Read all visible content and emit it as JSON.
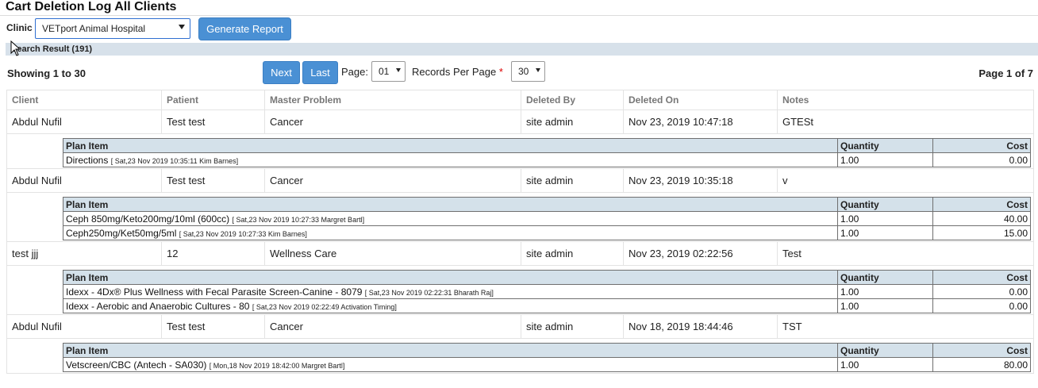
{
  "page": {
    "title": "Cart Deletion Log All Clients"
  },
  "filter": {
    "clinic_label": "Clinic",
    "clinic_value": "VETport Animal Hospital",
    "generate_label": "Generate Report"
  },
  "search": {
    "result_label": "Search Result (191)"
  },
  "pager": {
    "showing": "Showing 1 to 30",
    "next_label": "Next",
    "last_label": "Last",
    "page_label": "Page:",
    "page_value": "01",
    "rpp_label": "Records Per Page",
    "rpp_required": "*",
    "rpp_value": "30",
    "page_of": "Page 1 of 7"
  },
  "table": {
    "headers": [
      "Client",
      "Patient",
      "Master Problem",
      "Deleted By",
      "Deleted On",
      "Notes"
    ],
    "sub_headers": [
      "Plan Item",
      "Quantity",
      "Cost"
    ],
    "records": [
      {
        "client": "Abdul Nufil",
        "patient": "Test test",
        "problem": "Cancer",
        "deleted_by": "site admin",
        "deleted_on": "Nov 23, 2019 10:47:18",
        "notes": "GTESt",
        "items": [
          {
            "name": "Directions",
            "meta": "[ Sat,23 Nov 2019 10:35:11 Kim Barnes]",
            "qty": "1.00",
            "cost": "0.00"
          }
        ]
      },
      {
        "client": "Abdul Nufil",
        "patient": "Test test",
        "problem": "Cancer",
        "deleted_by": "site admin",
        "deleted_on": "Nov 23, 2019 10:35:18",
        "notes": "v",
        "items": [
          {
            "name": "Ceph 850mg/Keto200mg/10ml (600cc)",
            "meta": "[ Sat,23 Nov 2019 10:27:33 Margret Bartl]",
            "qty": "1.00",
            "cost": "40.00"
          },
          {
            "name": "Ceph250mg/Ket50mg/5ml",
            "meta": "[ Sat,23 Nov 2019 10:27:33 Kim Barnes]",
            "qty": "1.00",
            "cost": "15.00"
          }
        ]
      },
      {
        "client": "test jjj",
        "patient": "12",
        "problem": "Wellness Care",
        "deleted_by": "site admin",
        "deleted_on": "Nov 23, 2019 02:22:56",
        "notes": "Test",
        "items": [
          {
            "name": "Idexx - 4Dx® Plus Wellness with Fecal Parasite Screen-Canine - 8079",
            "meta": "[ Sat,23 Nov 2019 02:22:31 Bharath Raj]",
            "qty": "1.00",
            "cost": "0.00"
          },
          {
            "name": "Idexx - Aerobic and Anaerobic Cultures - 80",
            "meta": "[ Sat,23 Nov 2019 02:22:49 Activation Timing]",
            "qty": "1.00",
            "cost": "0.00"
          }
        ]
      },
      {
        "client": "Abdul Nufil",
        "patient": "Test test",
        "problem": "Cancer",
        "deleted_by": "site admin",
        "deleted_on": "Nov 18, 2019 18:44:46",
        "notes": "TST",
        "items": [
          {
            "name": "Vetscreen/CBC (Antech - SA030)",
            "meta": "[ Mon,18 Nov 2019 18:42:00 Margret Bartl]",
            "qty": "1.00",
            "cost": "80.00"
          }
        ]
      }
    ]
  },
  "icons": {
    "cursor": "mouse-pointer-icon",
    "dropdown": "chevron-down-icon"
  },
  "colors": {
    "button": "#4a90d4",
    "header_band": "#d7e1ea",
    "subheader": "#d4e1ea",
    "required": "#dd0000"
  }
}
